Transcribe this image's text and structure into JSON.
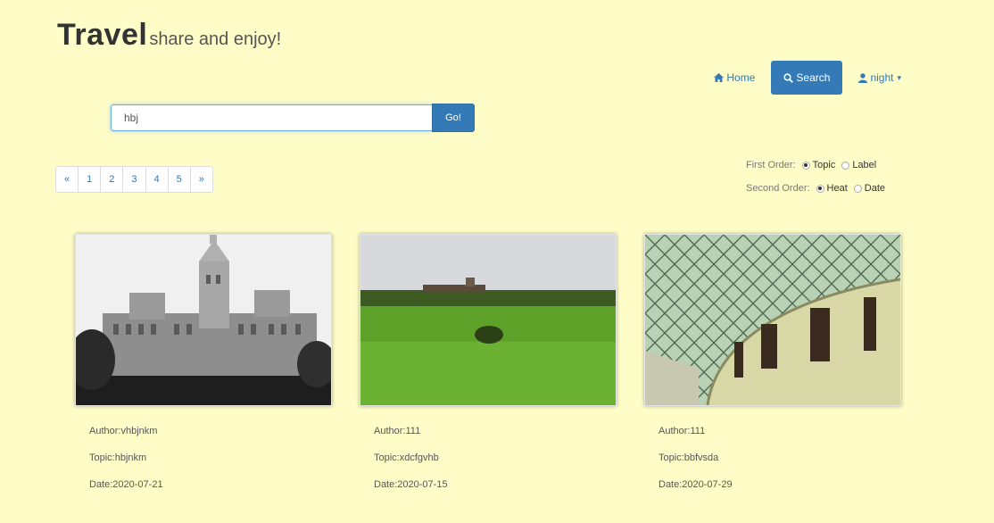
{
  "brand": {
    "title": "Travel",
    "slogan": "share and enjoy!"
  },
  "nav": {
    "home": "Home",
    "search": "Search",
    "user": "night"
  },
  "search": {
    "value": "hbj",
    "button": "Go!"
  },
  "pagination": [
    "«",
    "1",
    "2",
    "3",
    "4",
    "5",
    "»"
  ],
  "order": {
    "first_label": "First Order:",
    "first_options": [
      {
        "label": "Topic",
        "checked": true
      },
      {
        "label": "Label",
        "checked": false
      }
    ],
    "second_label": "Second Order:",
    "second_options": [
      {
        "label": "Heat",
        "checked": true
      },
      {
        "label": "Date",
        "checked": false
      }
    ]
  },
  "cards": [
    {
      "author": "Author:vhbjnkm",
      "topic": "Topic:hbjnkm",
      "date": "Date:2020-07-21",
      "image": "palace-photo"
    },
    {
      "author": "Author:111",
      "topic": "Topic:xdcfgvhb",
      "date": "Date:2020-07-15",
      "image": "green-field-photo"
    },
    {
      "author": "Author:111",
      "topic": "Topic:bbfvsda",
      "date": "Date:2020-07-29",
      "image": "glass-roof-court-photo"
    }
  ],
  "colors": {
    "background": "#fefdc8",
    "primary": "#337ab7"
  }
}
